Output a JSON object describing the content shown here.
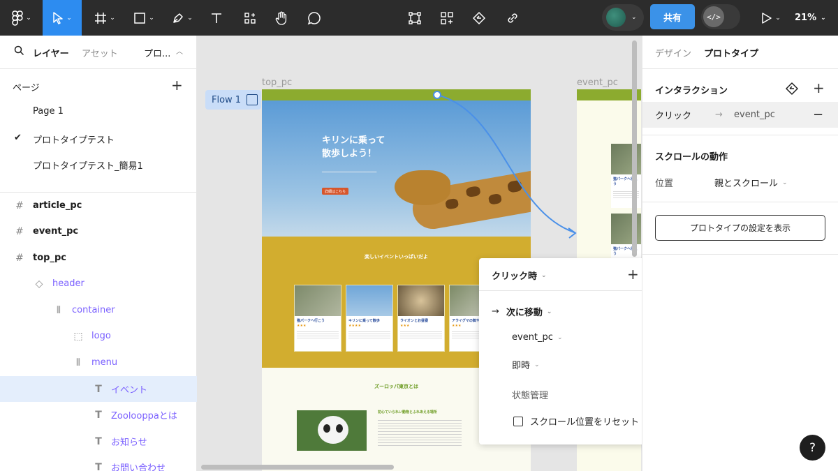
{
  "toolbar": {
    "share_label": "共有",
    "zoom_label": "21%",
    "dev_mode_icon": "code-icon"
  },
  "left_panel": {
    "tabs": [
      "レイヤー",
      "アセット",
      "プロ..."
    ],
    "pages_header": "ページ",
    "pages": [
      {
        "label": "Page 1",
        "selected": false
      },
      {
        "label": "プロトタイプテスト",
        "selected": true
      },
      {
        "label": "プロトタイプテスト_簡易1",
        "selected": false
      }
    ],
    "layers": [
      {
        "label": "article_pc",
        "type": "frame"
      },
      {
        "label": "event_pc",
        "type": "frame"
      },
      {
        "label": "top_pc",
        "type": "frame"
      },
      {
        "label": "header",
        "type": "component"
      },
      {
        "label": "container",
        "type": "autolayout"
      },
      {
        "label": "logo",
        "type": "group"
      },
      {
        "label": "menu",
        "type": "autolayout"
      },
      {
        "label": "イベント",
        "type": "text",
        "selected": true
      },
      {
        "label": "Zoolooppaとは",
        "type": "text"
      },
      {
        "label": "お知らせ",
        "type": "text"
      },
      {
        "label": "お問い合わせ",
        "type": "text"
      }
    ]
  },
  "canvas": {
    "frame_top_label": "top_pc",
    "frame_event_label": "event_pc",
    "flow_label": "Flow 1",
    "hero_title_line1": "キリンに乗って",
    "hero_title_line2": "散歩しよう！",
    "hero_button": "詳細はこちら",
    "events_title": "楽しいイベントいっぱいだよ",
    "cards": [
      {
        "title": "猫パークへ行こう",
        "stars": "★★★"
      },
      {
        "title": "キリンに乗って散歩",
        "stars": "★★★★"
      },
      {
        "title": "ライオンとお昼寝",
        "stars": "★★★"
      },
      {
        "title": "アライグマの餌やり",
        "stars": "★★★"
      }
    ],
    "about_title": "ズーロッパ東京とは",
    "about_head": "初心ていられい動物とふれあえる場所",
    "event_cards": [
      "猫パークへ行こう",
      "猫パークへ行こう"
    ]
  },
  "popup": {
    "trigger": "クリック時",
    "action": "次に移動",
    "destination": "event_pc",
    "animation": "即時",
    "state_mgmt": "状態管理",
    "reset_scroll": "スクロール位置をリセット"
  },
  "right_panel": {
    "tabs": [
      "デザイン",
      "プロトタイプ"
    ],
    "interaction_header": "インタラクション",
    "interaction_trigger": "クリック",
    "interaction_target": "event_pc",
    "scroll_header": "スクロールの動作",
    "position_label": "位置",
    "position_value": "親とスクロール",
    "proto_settings_button": "プロトタイプの設定を表示"
  },
  "help_label": "?"
}
